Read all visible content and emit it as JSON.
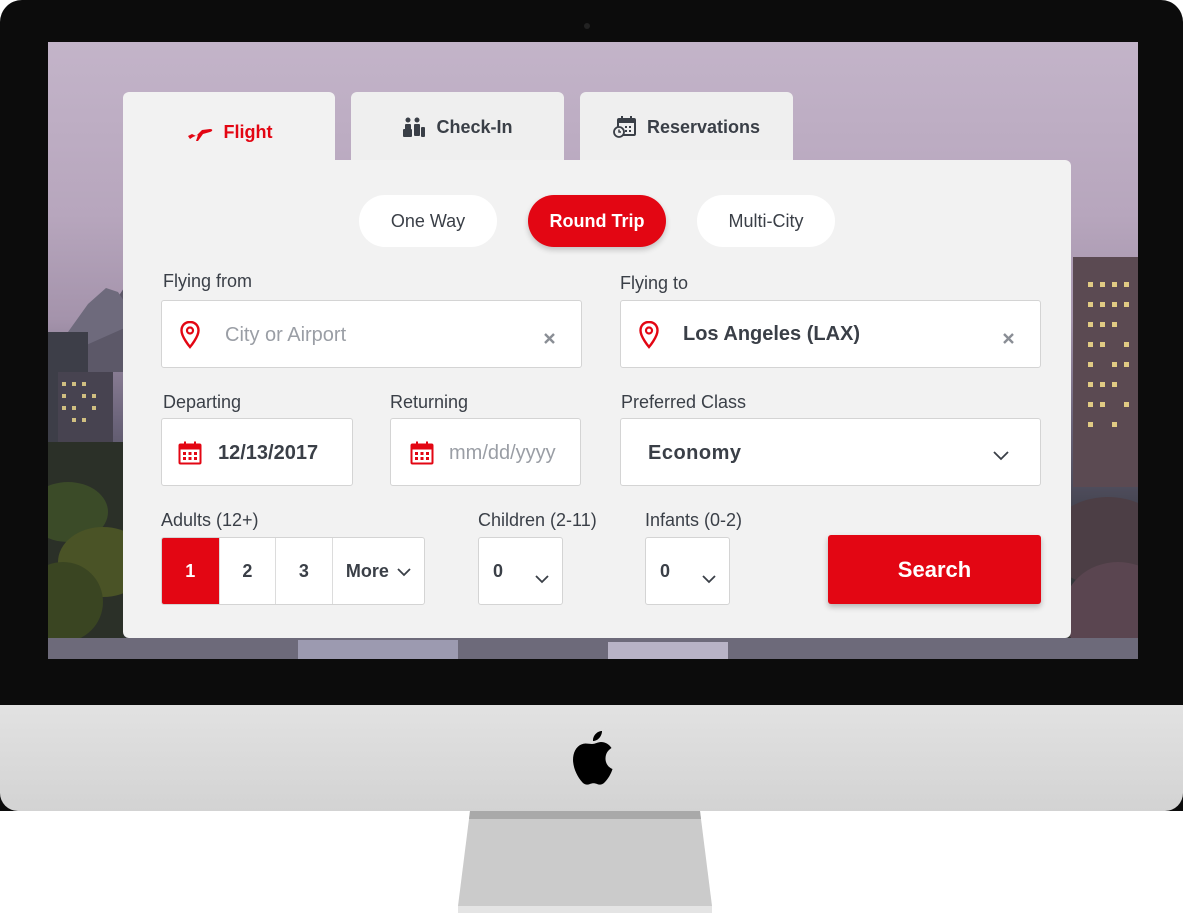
{
  "tabs": [
    {
      "label": "Flight",
      "icon": "plane-icon",
      "active": true
    },
    {
      "label": "Check-In",
      "icon": "check-in-icon",
      "active": false
    },
    {
      "label": "Reservations",
      "icon": "calendar-clock-icon",
      "active": false
    }
  ],
  "trip_types": [
    {
      "label": "One Way",
      "active": false
    },
    {
      "label": "Round Trip",
      "active": true
    },
    {
      "label": "Multi-City",
      "active": false
    }
  ],
  "flying_from": {
    "label": "Flying from",
    "placeholder": "City or Airport",
    "value": ""
  },
  "flying_to": {
    "label": "Flying to",
    "value": "Los Angeles (LAX)"
  },
  "departing": {
    "label": "Departing",
    "value": "12/13/2017"
  },
  "returning": {
    "label": "Returning",
    "placeholder": "mm/dd/yyyy",
    "value": ""
  },
  "preferred_class": {
    "label": "Preferred Class",
    "value": "Economy"
  },
  "adults": {
    "label": "Adults (12+)",
    "options": [
      "1",
      "2",
      "3"
    ],
    "more_label": "More",
    "selected": "1"
  },
  "children": {
    "label": "Children (2-11)",
    "value": "0"
  },
  "infants": {
    "label": "Infants (0-2)",
    "value": "0"
  },
  "search_label": "Search",
  "colors": {
    "accent": "#e30613",
    "text": "#3a3f47",
    "panel": "#f2f2f2"
  }
}
